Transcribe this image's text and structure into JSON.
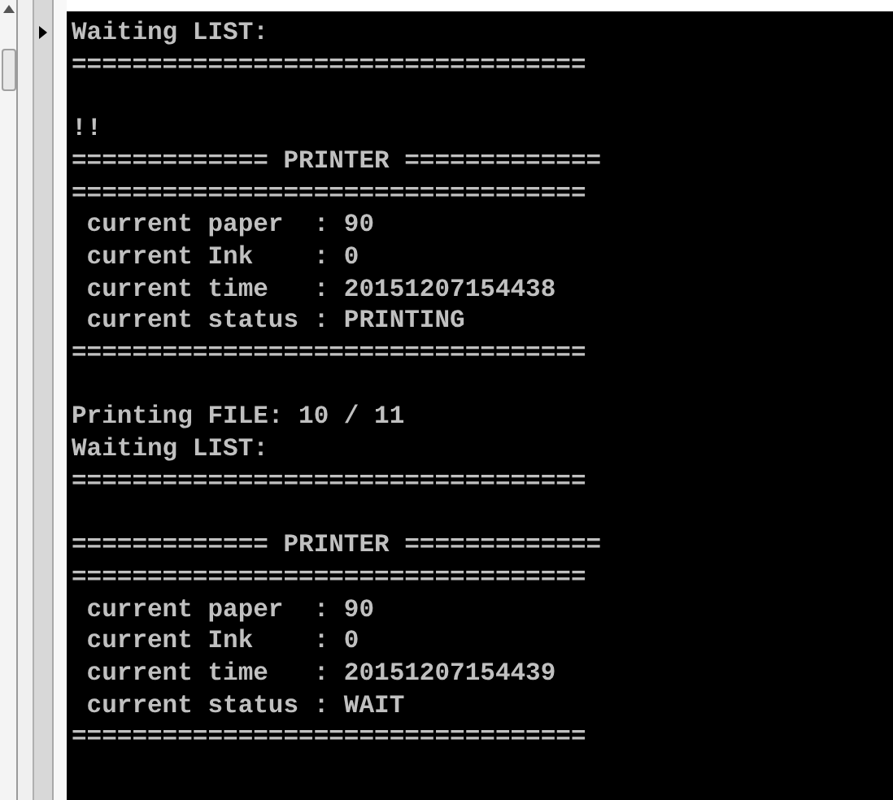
{
  "console": {
    "blocks": [
      {
        "lines": [
          "Waiting LIST:",
          "=================================="
        ]
      },
      {
        "lines": [
          "!!",
          "============= PRINTER =============",
          "==================================",
          " current paper  : 90",
          " current Ink    : 0",
          " current time   : 20151207154438",
          " current status : PRINTING",
          "=================================="
        ]
      },
      {
        "lines": [
          "Printing FILE: 10 / 11",
          "Waiting LIST:",
          "=================================="
        ]
      },
      {
        "lines": [
          "============= PRINTER =============",
          "==================================",
          " current paper  : 90",
          " current Ink    : 0",
          " current time   : 20151207154439",
          " current status : WAIT",
          "=================================="
        ]
      }
    ]
  }
}
